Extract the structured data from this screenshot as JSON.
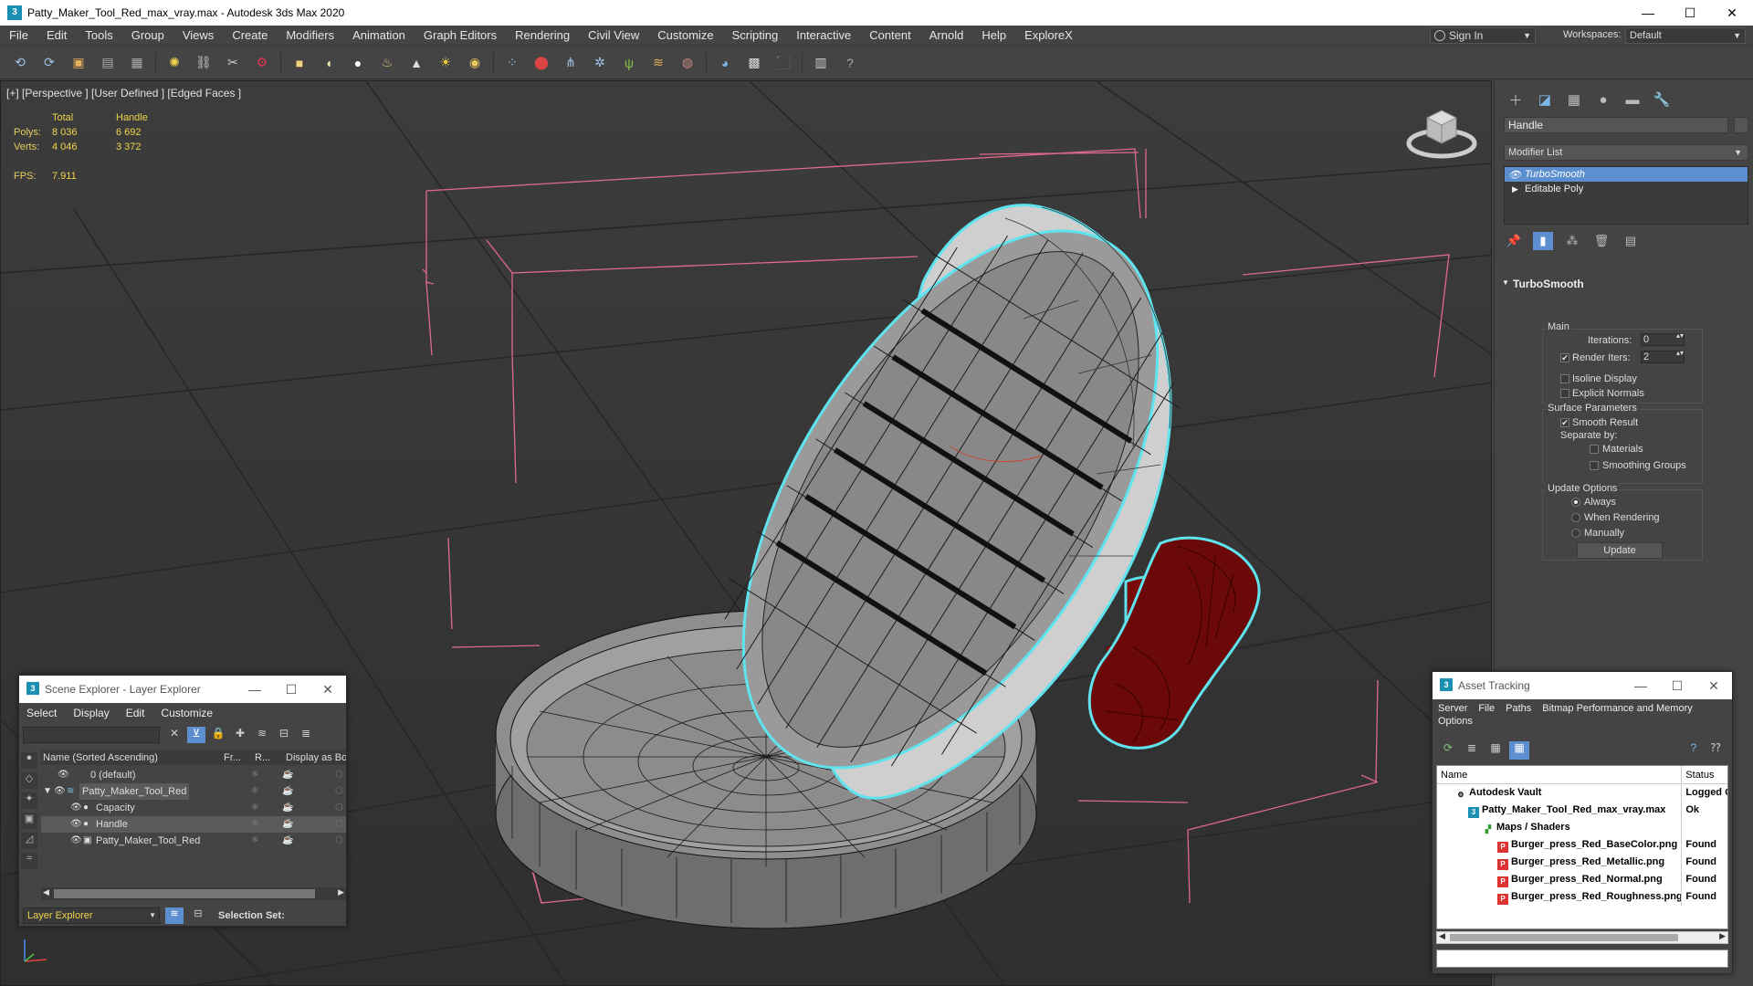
{
  "window": {
    "title": "Patty_Maker_Tool_Red_max_vray.max - Autodesk 3ds Max 2020",
    "app_icon": "3",
    "minimize": "—",
    "maximize": "☐",
    "close": "✕"
  },
  "menu": {
    "items": [
      "File",
      "Edit",
      "Tools",
      "Group",
      "Views",
      "Create",
      "Modifiers",
      "Animation",
      "Graph Editors",
      "Rendering",
      "Civil View",
      "Customize",
      "Scripting",
      "Interactive",
      "Content",
      "Arnold",
      "Help",
      "ExploreX"
    ],
    "sign_in": "Sign In",
    "workspaces_label": "Workspaces:",
    "workspaces_value": "Default"
  },
  "toolbar": {
    "icons": [
      "undo-icon",
      "redo-icon",
      "render-setup-icon",
      "material-editor-icon",
      "layer-icon",
      "light-bulb-icon",
      "link-icon",
      "unlink-icon",
      "bind-icon",
      "box-icon",
      "sphere-icon",
      "geosphere-icon",
      "teapot-icon",
      "cone-icon",
      "sun-icon",
      "omni-light-icon",
      "particles-icon",
      "dynamics-icon",
      "array-icon",
      "settings-icon",
      "grass-icon",
      "hair-icon",
      "wood-icon",
      "globe-icon",
      "render-frame-icon",
      "render-icon",
      "script-icon",
      "help-icon"
    ]
  },
  "viewport": {
    "label": "[+] [Perspective ] [User Defined ] [Edged Faces ]",
    "stats": {
      "col_total": "Total",
      "col_handle": "Handle",
      "polys_label": "Polys:",
      "polys_total": "8 036",
      "polys_handle": "6 692",
      "verts_label": "Verts:",
      "verts_total": "4 046",
      "verts_handle": "3 372",
      "fps_label": "FPS:",
      "fps_value": "7.911"
    }
  },
  "command_panel": {
    "tabs": [
      "create-icon",
      "modify-icon",
      "hierarchy-icon",
      "motion-icon",
      "display-icon",
      "utilities-icon"
    ],
    "object_name": "Handle",
    "modifier_list": "Modifier List",
    "stack": [
      {
        "label": "TurboSmooth",
        "selected": true
      },
      {
        "label": "Editable Poly",
        "selected": false
      }
    ],
    "rollout": {
      "title": "TurboSmooth",
      "main_label": "Main",
      "iterations_label": "Iterations:",
      "iterations_value": "0",
      "render_iters_label": "Render Iters:",
      "render_iters_value": "2",
      "render_iters_checked": true,
      "isoline_label": "Isoline Display",
      "explicit_normals_label": "Explicit Normals",
      "surface_label": "Surface Parameters",
      "smooth_result_label": "Smooth Result",
      "separate_by_label": "Separate by:",
      "materials_label": "Materials",
      "smoothing_groups_label": "Smoothing Groups",
      "update_options_label": "Update Options",
      "always_label": "Always",
      "when_rendering_label": "When Rendering",
      "manually_label": "Manually",
      "update_button": "Update"
    }
  },
  "scene_explorer": {
    "title": "Scene Explorer - Layer Explorer",
    "menu": [
      "Select",
      "Display",
      "Edit",
      "Customize"
    ],
    "col_name": "Name (Sorted Ascending)",
    "col_frozen": "Fr...",
    "col_render": "R...",
    "col_display": "Display as Box",
    "rows": [
      {
        "name": "0 (default)",
        "indent": 0
      },
      {
        "name": "Patty_Maker_Tool_Red",
        "indent": 1
      },
      {
        "name": "Capacity",
        "indent": 2
      },
      {
        "name": "Handle",
        "indent": 2
      },
      {
        "name": "Patty_Maker_Tool_Red",
        "indent": 2
      }
    ],
    "layer_explorer": "Layer Explorer",
    "selection_set": "Selection Set:"
  },
  "asset_tracking": {
    "title": "Asset Tracking",
    "menu": [
      "Server",
      "File",
      "Paths",
      "Bitmap Performance and Memory"
    ],
    "menu2": "Options",
    "col_name": "Name",
    "col_status": "Status",
    "rows": [
      {
        "name": "Autodesk Vault",
        "status": "Logged O",
        "indent": 1
      },
      {
        "name": "Patty_Maker_Tool_Red_max_vray.max",
        "status": "Ok",
        "indent": 2
      },
      {
        "name": "Maps / Shaders",
        "status": "",
        "indent": 3
      },
      {
        "name": "Burger_press_Red_BaseColor.png",
        "status": "Found",
        "indent": 4
      },
      {
        "name": "Burger_press_Red_Metallic.png",
        "status": "Found",
        "indent": 4
      },
      {
        "name": "Burger_press_Red_Normal.png",
        "status": "Found",
        "indent": 4
      },
      {
        "name": "Burger_press_Red_Roughness.png",
        "status": "Found",
        "indent": 4
      }
    ]
  },
  "colors": {
    "accent": "#5b8fd0",
    "selection_outline": "#5fe4ef",
    "handle_red": "#7a0a0a",
    "bbox_pink": "#e06a8a",
    "stats_yellow": "#f0d44c"
  }
}
